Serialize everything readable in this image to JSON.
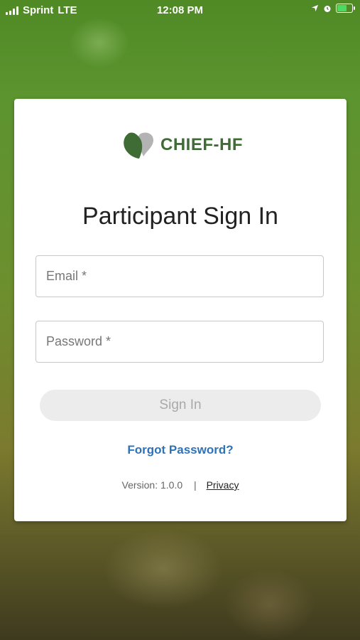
{
  "status_bar": {
    "carrier": "Sprint",
    "network": "LTE",
    "time": "12:08 PM",
    "battery_level": 0.6
  },
  "app": {
    "logo_text": "CHIEF-HF",
    "colors": {
      "logo_dark": "#3f6b34",
      "logo_gray": "#b3b3b3",
      "link": "#2e72b7"
    }
  },
  "signin": {
    "title": "Participant Sign In",
    "email_placeholder": "Email *",
    "password_placeholder": "Password *",
    "button_label": "Sign In",
    "forgot_link": "Forgot Password?",
    "version_text": "Version: 1.0.0",
    "separator": "|",
    "privacy_link": "Privacy"
  },
  "icons": [
    "signal-icon",
    "location-arrow-icon",
    "alarm-icon",
    "battery-icon",
    "heart-leaf-logo-icon"
  ]
}
